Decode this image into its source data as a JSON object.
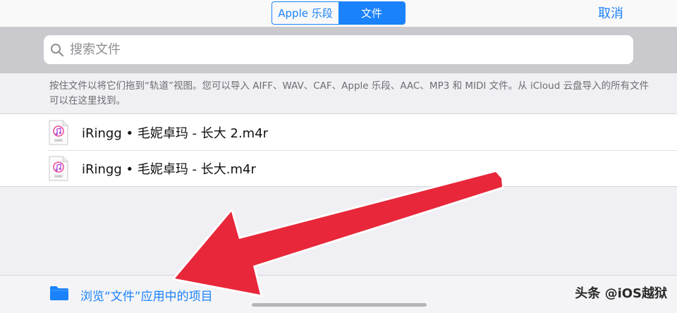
{
  "header": {
    "tabs": [
      {
        "label": "Apple 乐段",
        "selected": false
      },
      {
        "label": "文件",
        "selected": true
      }
    ],
    "cancel_label": "取消"
  },
  "search": {
    "placeholder": "搜索文件",
    "value": ""
  },
  "hint_text": "按住文件以将它们拖到“轨道”视图。您可以导入 AIFF、WAV、CAF、Apple 乐段、AAC、MP3 和 MIDI 文件。从 iCloud 云盘导入的所有文件可以在这里找到。",
  "files": [
    {
      "name": "iRingg • 毛妮卓玛 - 长大 2.m4r",
      "icon": "m4r-file-icon",
      "icon_label": "M4R"
    },
    {
      "name": "iRingg • 毛妮卓玛 - 长大.m4r",
      "icon": "m4r-file-icon",
      "icon_label": "M4R"
    }
  ],
  "footer": {
    "browse_label": "浏览“文件”应用中的项目",
    "browse_icon": "folder-icon"
  },
  "watermark": "头条 @iOS越狱",
  "colors": {
    "accent": "#1a82fb",
    "arrow": "#e8273a",
    "search_band": "#c9c9ce",
    "background": "#efeff4"
  }
}
